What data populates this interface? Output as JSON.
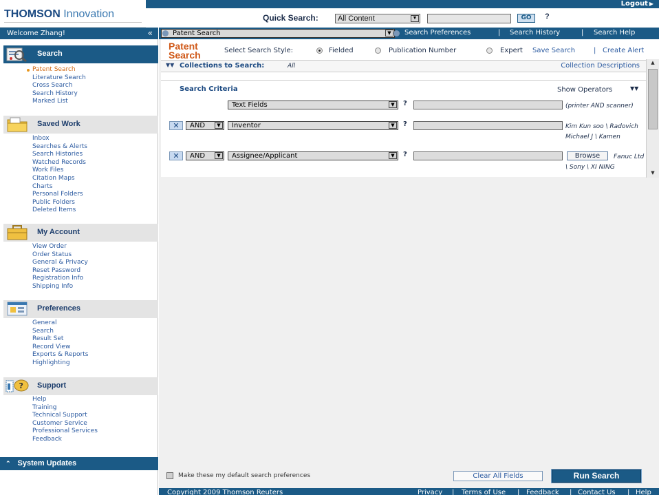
{
  "header": {
    "logo_bold": "THOMSON",
    "logo_light": "Innovation",
    "logout": "Logout",
    "quick_search_label": "Quick Search:",
    "quick_search_scope": "All Content",
    "quick_search_value": "",
    "go": "GO",
    "help": "?"
  },
  "sidebar": {
    "welcome": "Welcome Zhang!",
    "collapse": "«",
    "sections": [
      {
        "title": "Search",
        "icon": "search-magnifier-icon",
        "items": [
          "Patent Search",
          "Literature Search",
          "Cross Search",
          "Search History",
          "Marked List"
        ]
      },
      {
        "title": "Saved Work",
        "icon": "folder-icon",
        "items": [
          "Inbox",
          "Searches & Alerts",
          "Search Histories",
          "Watched Records",
          "Work Files",
          "Citation Maps",
          "Charts",
          "Personal Folders",
          "Public Folders",
          "Deleted Items"
        ]
      },
      {
        "title": "My Account",
        "icon": "briefcase-icon",
        "items": [
          "View Order",
          "Order Status",
          "General & Privacy",
          "Reset Password",
          "Registration Info",
          "Shipping Info"
        ]
      },
      {
        "title": "Preferences",
        "icon": "window-settings-icon",
        "items": [
          "General",
          "Search",
          "Result Set",
          "Record View",
          "Exports & Reports",
          "Highlighting"
        ]
      },
      {
        "title": "Support",
        "icon": "help-bubble-icon",
        "items": [
          "Help",
          "Training",
          "Technical Support",
          "Customer Service",
          "Professional Services",
          "Feedback"
        ]
      }
    ],
    "system_updates": "System Updates",
    "system_updates_chevron": "⌃"
  },
  "main": {
    "search_type": "Patent Search",
    "top_links": [
      "Search Preferences",
      "Search History",
      "Search Help"
    ],
    "title_line1": "Patent",
    "title_line2": "Search",
    "style_label": "Select Search Style:",
    "styles": [
      "Fielded",
      "Publication Number",
      "Expert"
    ],
    "selected_style": "Fielded",
    "save_search": "Save Search",
    "create_alert": "Create Alert",
    "collections_label": "Collections to Search:",
    "collections_value": "All",
    "collection_descriptions": "Collection Descriptions",
    "criteria_title": "Search Criteria",
    "show_operators": "Show Operators",
    "rows": [
      {
        "operator": "",
        "field": "Text Fields",
        "value": "",
        "hint": "(printer AND scanner)"
      },
      {
        "operator": "AND",
        "field": "Inventor",
        "value": "",
        "hint": "Kim Kun soo \\ Radovich Michael J \\ Kamen"
      },
      {
        "operator": "AND",
        "field": "Assignee/Applicant",
        "value": "",
        "browse": "Browse",
        "hint": "Fanuc Ltd \\ Sony \\ XI NING"
      }
    ],
    "remove_symbol": "✕",
    "help_symbol": "?"
  },
  "bottom": {
    "default_prefs_label": "Make these my default search preferences",
    "clear_all": "Clear All Fields",
    "run_search": "Run Search"
  },
  "footer": {
    "copyright": "Copyright 2009 Thomson Reuters",
    "links": [
      "Privacy",
      "Terms of Use",
      "Feedback",
      "Contact Us",
      "Help"
    ]
  },
  "colors": {
    "brand_blue": "#1b5a86",
    "title_orange": "#d05a1a",
    "link_blue": "#2b5aa0"
  }
}
